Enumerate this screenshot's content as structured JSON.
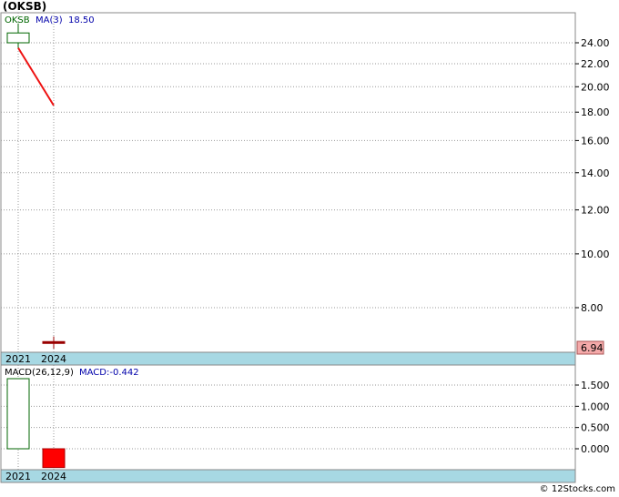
{
  "header": {
    "title": "(OKSB)"
  },
  "footer": {
    "credit": "© 12Stocks.com"
  },
  "chart_data": [
    {
      "type": "candlestick",
      "legend": {
        "symbol": "OKSB",
        "ma_label": "MA(3)",
        "ma_value": "18.50"
      },
      "categories": [
        "2021",
        "2024"
      ],
      "series": [
        {
          "name": "OKSB",
          "values": [
            {
              "x": "2021",
              "open": 24.0,
              "high": 26.0,
              "low": 23.5,
              "close": 25.0
            },
            {
              "x": "2024",
              "open": 6.95,
              "high": 7.1,
              "low": 6.75,
              "close": 6.94
            }
          ]
        },
        {
          "name": "MA(3)",
          "values": [
            {
              "x": "2021",
              "y": 23.5
            },
            {
              "x": "2024",
              "y": 18.5
            }
          ]
        }
      ],
      "scale": "log",
      "ylim": [
        6.5,
        28
      ],
      "yticks": [
        8.0,
        10.0,
        12.0,
        14.0,
        16.0,
        18.0,
        20.0,
        22.0,
        24.0
      ],
      "ytick_labels": [
        "8.00",
        "10.00",
        "12.00",
        "14.00",
        "16.00",
        "18.00",
        "20.00",
        "22.00",
        "24.00"
      ],
      "last_price": "6.94",
      "colors": {
        "up": "#006600",
        "down": "#990000",
        "ma": "#ee1111",
        "last_badge": "#f4a9a9",
        "axis_band": "#a7d8e3"
      }
    },
    {
      "type": "bar",
      "legend": {
        "label": "MACD(26,12,9)",
        "value_label": "MACD:-0.442"
      },
      "categories": [
        "2021",
        "2024"
      ],
      "series": [
        {
          "name": "MACD",
          "values": [
            1.65,
            -0.442
          ]
        }
      ],
      "ylim": [
        -0.5,
        1.85
      ],
      "yticks": [
        0.0,
        0.5,
        1.0,
        1.5
      ],
      "ytick_labels": [
        "0.000",
        "0.500",
        "1.000",
        "1.500"
      ],
      "colors": {
        "positive": "#006600",
        "negative": "#ff0000"
      }
    }
  ]
}
